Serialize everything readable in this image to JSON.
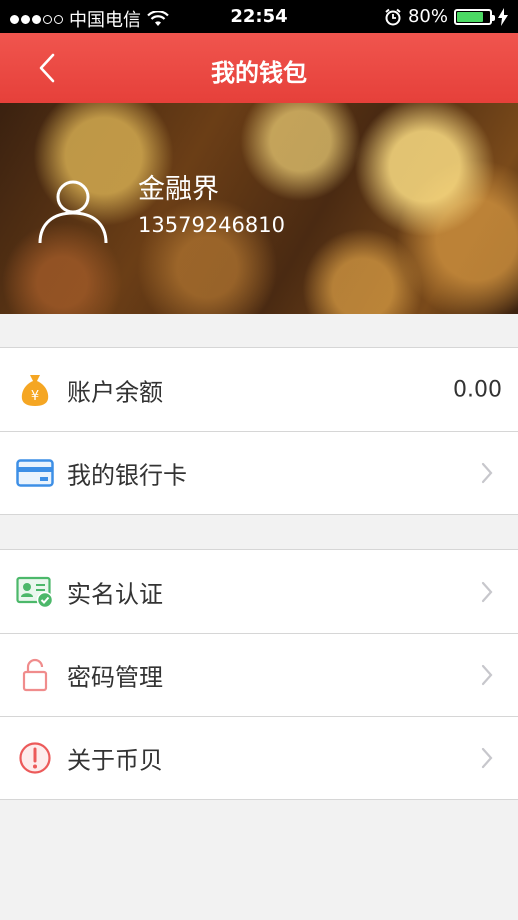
{
  "status_bar": {
    "carrier": "中国电信",
    "time": "22:54",
    "battery_percent": "80%",
    "battery_level": 0.8,
    "signal_dots_filled": 3,
    "signal_dots_total": 5
  },
  "nav": {
    "title": "我的钱包",
    "back_icon": "chevron-left-icon"
  },
  "profile": {
    "name": "金融界",
    "phone": "13579246810",
    "avatar_icon": "user-avatar-icon"
  },
  "wallet_group": [
    {
      "icon": "money-bag-icon",
      "label": "账户余额",
      "value": "0.00"
    },
    {
      "icon": "bank-card-icon",
      "label": "我的银行卡",
      "value": ""
    }
  ],
  "settings_group": [
    {
      "icon": "id-card-verified-icon",
      "label": "实名认证"
    },
    {
      "icon": "lock-icon",
      "label": "密码管理"
    },
    {
      "icon": "info-alert-icon",
      "label": "关于币贝"
    }
  ],
  "colors": {
    "nav_red": "#e6403a",
    "coin_orange": "#f5a623",
    "card_blue": "#3d8fe6",
    "id_green": "#4cb86a",
    "lock_pink": "#f08c8c",
    "alert_red": "#ec5a5a",
    "battery_green": "#4cd964"
  }
}
